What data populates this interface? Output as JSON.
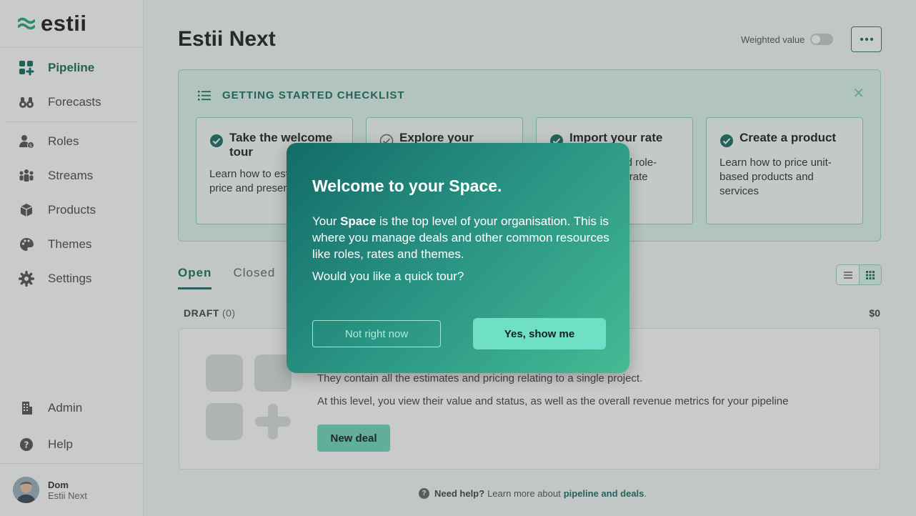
{
  "brand": {
    "logo_text": "estii",
    "accent": "#1b6b5f"
  },
  "sidebar": {
    "items": [
      {
        "label": "Pipeline",
        "icon": "pipeline-icon",
        "active": true
      },
      {
        "label": "Forecasts",
        "icon": "binoculars-icon"
      },
      {
        "label": "Roles",
        "icon": "roles-icon"
      },
      {
        "label": "Streams",
        "icon": "streams-icon"
      },
      {
        "label": "Products",
        "icon": "cube-icon"
      },
      {
        "label": "Themes",
        "icon": "palette-icon"
      },
      {
        "label": "Settings",
        "icon": "gear-icon"
      }
    ],
    "bottom": [
      {
        "label": "Admin",
        "icon": "building-icon"
      },
      {
        "label": "Help",
        "icon": "help-icon"
      }
    ],
    "user": {
      "name": "Dom",
      "org": "Estii Next"
    }
  },
  "header": {
    "title": "Estii Next",
    "weighted_label": "Weighted value",
    "weighted_on": false
  },
  "checklist": {
    "title": "GETTING STARTED CHECKLIST",
    "cards": [
      {
        "title": "Take the welcome tour",
        "desc": "Learn how to estimate, price and present a deal",
        "done": true
      },
      {
        "title": "Explore your space",
        "desc": "",
        "done": false
      },
      {
        "title": "Import your rate",
        "desc": "Learn how to add role-based rates and rate",
        "done": true
      },
      {
        "title": "Create a product",
        "desc": "Learn how to price unit-based products and services",
        "done": true
      }
    ]
  },
  "tabs": [
    {
      "label": "Open",
      "active": true
    },
    {
      "label": "Closed",
      "active": false
    }
  ],
  "draft": {
    "label": "DRAFT",
    "count": "(0)",
    "value": "$0"
  },
  "empty": {
    "line1": "They contain all the estimates and pricing relating to a single project.",
    "line2": "At this level, you view their value and status, as well as the overall revenue metrics for your pipeline",
    "button": "New deal"
  },
  "help": {
    "bold": "Need help?",
    "text": "Learn more about",
    "link": "pipeline and deals",
    "end": "."
  },
  "modal": {
    "title_pre": "Welcome to your ",
    "title_bold": "Space",
    "title_post": ".",
    "body_pre": "Your ",
    "body_bold": "Space",
    "body_post": " is the top level of your organisation. This is where you manage deals and other common resources like roles, rates and themes.",
    "question": "Would you like a quick tour?",
    "btn_no": "Not right now",
    "btn_yes": "Yes, show me"
  }
}
